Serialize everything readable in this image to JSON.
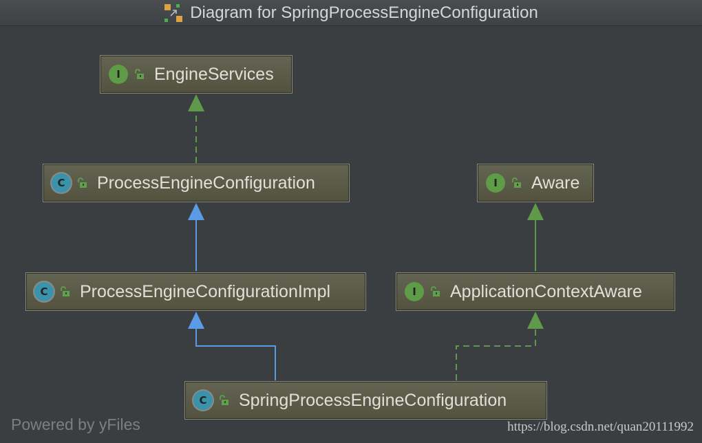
{
  "title": "Diagram for SpringProcessEngineConfiguration",
  "nodes": {
    "engine_services": {
      "kind": "I",
      "label": "EngineServices"
    },
    "process_engine_configuration": {
      "kind": "C",
      "label": "ProcessEngineConfiguration"
    },
    "aware": {
      "kind": "I",
      "label": "Aware"
    },
    "process_engine_configuration_impl": {
      "kind": "C",
      "label": "ProcessEngineConfigurationImpl"
    },
    "application_context_aware": {
      "kind": "I",
      "label": "ApplicationContextAware"
    },
    "spring_process_engine_configuration": {
      "kind": "C",
      "label": "SpringProcessEngineConfiguration"
    }
  },
  "edges": [
    {
      "from": "ProcessEngineConfiguration",
      "to": "EngineServices",
      "type": "implements"
    },
    {
      "from": "ProcessEngineConfigurationImpl",
      "to": "ProcessEngineConfiguration",
      "type": "extends"
    },
    {
      "from": "ApplicationContextAware",
      "to": "Aware",
      "type": "extends"
    },
    {
      "from": "SpringProcessEngineConfiguration",
      "to": "ProcessEngineConfigurationImpl",
      "type": "extends"
    },
    {
      "from": "SpringProcessEngineConfiguration",
      "to": "ApplicationContextAware",
      "type": "implements"
    }
  ],
  "colors": {
    "implements": "#5f9a4a",
    "extends": "#5b9be6"
  },
  "footer": {
    "powered_by": "Powered by yFiles",
    "watermark": "https://blog.csdn.net/quan20111992"
  }
}
